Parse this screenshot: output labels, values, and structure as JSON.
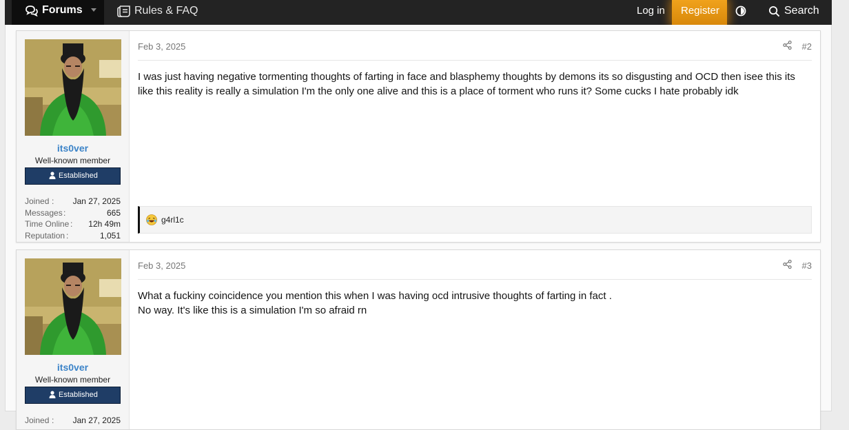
{
  "nav": {
    "forums_label": "Forums",
    "rules_label": "Rules & FAQ",
    "login_label": "Log in",
    "register_label": "Register",
    "search_label": "Search",
    "register_color": "#e8900f"
  },
  "posts": [
    {
      "username": "its0ver",
      "user_title": "Well-known member",
      "banner": "Established",
      "stats": [
        {
          "label": "Joined",
          "value": "Jan 27, 2025"
        },
        {
          "label": "Messages",
          "value": "665"
        },
        {
          "label": "Time Online",
          "value": "12h 49m"
        },
        {
          "label": "Reputation",
          "value": "1,051"
        }
      ],
      "date": "Feb 3, 2025",
      "number": "#2",
      "body": [
        "I was just having negative tormenting thoughts of farting in face and blasphemy thoughts by demons its so disgusting and OCD then isee this its like this reality is really a simulation I'm the only one alive and this is a place of torment who runs it? Some cucks I hate probably idk"
      ],
      "reaction_user": "g4rl1c"
    },
    {
      "username": "its0ver",
      "user_title": "Well-known member",
      "banner": "Established",
      "stats": [
        {
          "label": "Joined",
          "value": "Jan 27, 2025"
        }
      ],
      "date": "Feb 3, 2025",
      "number": "#3",
      "body": [
        "What a fuckiny coincidence you mention this when I was having ocd intrusive thoughts of farting in fact .",
        "No way. It's like this is a simulation I'm so afraid rn"
      ]
    }
  ]
}
